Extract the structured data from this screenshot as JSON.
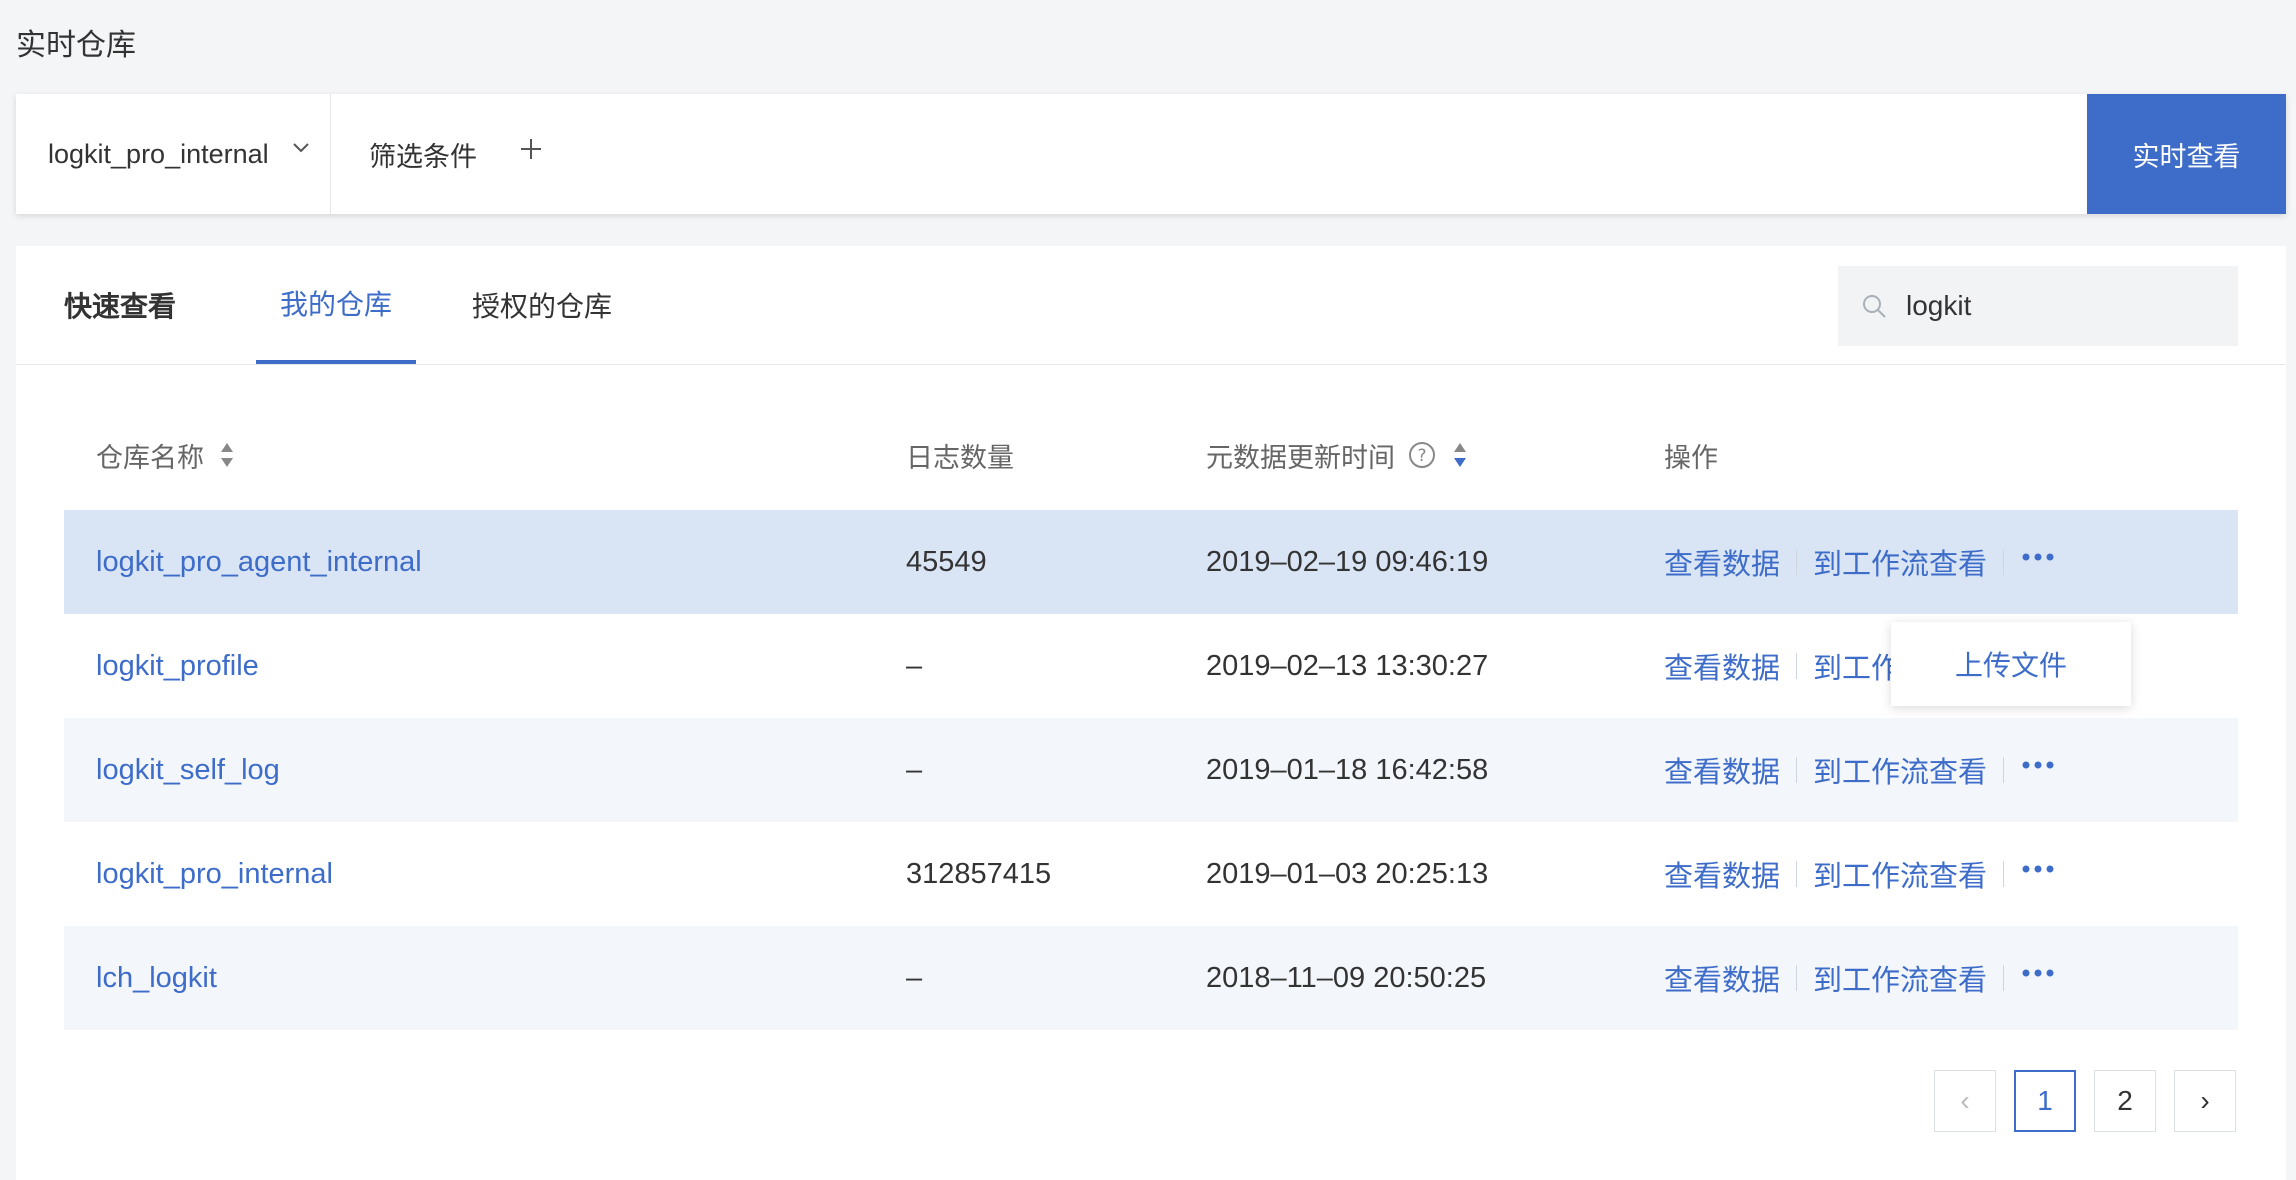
{
  "page": {
    "title": "实时仓库"
  },
  "query_bar": {
    "repo_selected": "logkit_pro_internal",
    "filter_label": "筛选条件",
    "submit_label": "实时查看"
  },
  "tabs": [
    {
      "label": "快速查看"
    },
    {
      "label": "我的仓库"
    },
    {
      "label": "授权的仓库"
    }
  ],
  "search": {
    "value": "logkit"
  },
  "table": {
    "headers": {
      "name": "仓库名称",
      "count": "日志数量",
      "time": "元数据更新时间",
      "ops": "操作"
    },
    "rows": [
      {
        "name": "logkit_pro_agent_internal",
        "count": "45549",
        "time": "2019–02–19 09:46:19"
      },
      {
        "name": "logkit_profile",
        "count": "–",
        "time": "2019–02–13 13:30:27"
      },
      {
        "name": "logkit_self_log",
        "count": "–",
        "time": "2019–01–18 16:42:58"
      },
      {
        "name": "logkit_pro_internal",
        "count": "312857415",
        "time": "2019–01–03 20:25:13"
      },
      {
        "name": "lch_logkit",
        "count": "–",
        "time": "2018–11–09 20:50:25"
      }
    ],
    "ops": {
      "view": "查看数据",
      "workflow": "到工作流查看",
      "workflow_truncated": "到工作流"
    }
  },
  "dropdown": {
    "upload": "上传文件"
  },
  "pagination": {
    "prev": "‹",
    "pages": [
      "1",
      "2"
    ],
    "next": "›",
    "current": "1"
  },
  "colors": {
    "accent": "#3d6cc9",
    "selected_row": "#d9e4f5",
    "alt_row": "#f3f6fb"
  }
}
